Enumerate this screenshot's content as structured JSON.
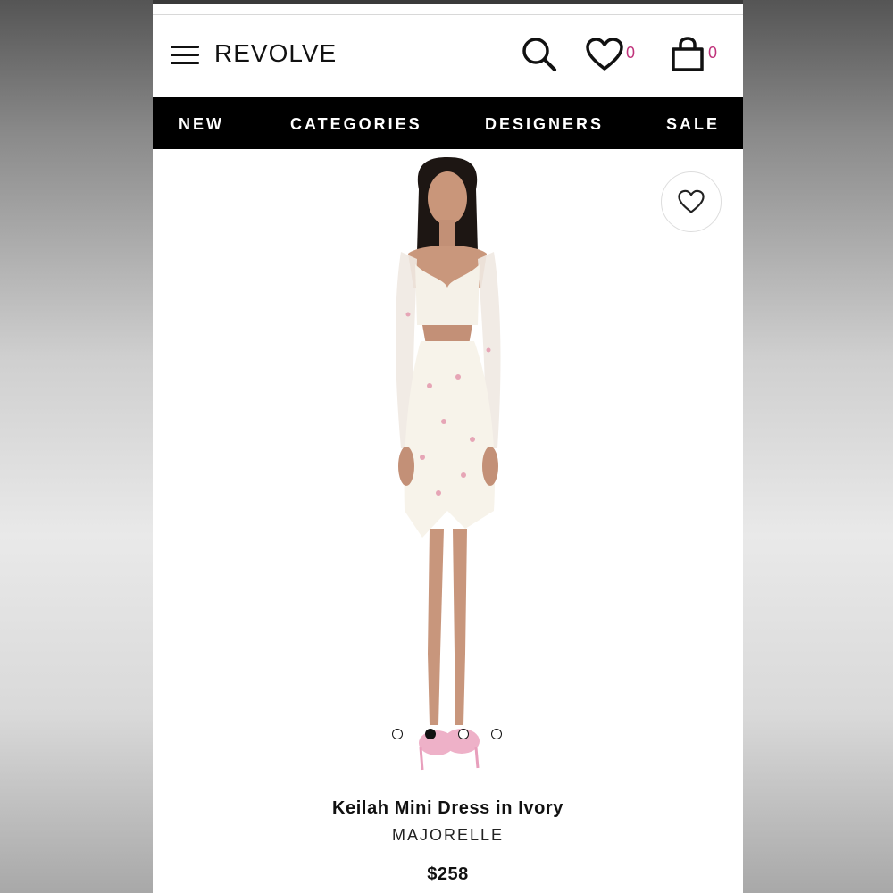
{
  "header": {
    "logo": "REVOLVE",
    "wishlist_count": "0",
    "cart_count": "0",
    "icons": [
      "menu-icon",
      "search-icon",
      "heart-icon",
      "bag-icon"
    ]
  },
  "nav": {
    "items": [
      "NEW",
      "CATEGORIES",
      "DESIGNERS",
      "SALE"
    ]
  },
  "product": {
    "name": "Keilah Mini Dress in Ivory",
    "brand": "MAJORELLE",
    "price": "$258",
    "image_count": 4,
    "active_image_index": 1
  },
  "colors": {
    "accent_pink": "#c0337b",
    "nav_background": "#000000"
  }
}
